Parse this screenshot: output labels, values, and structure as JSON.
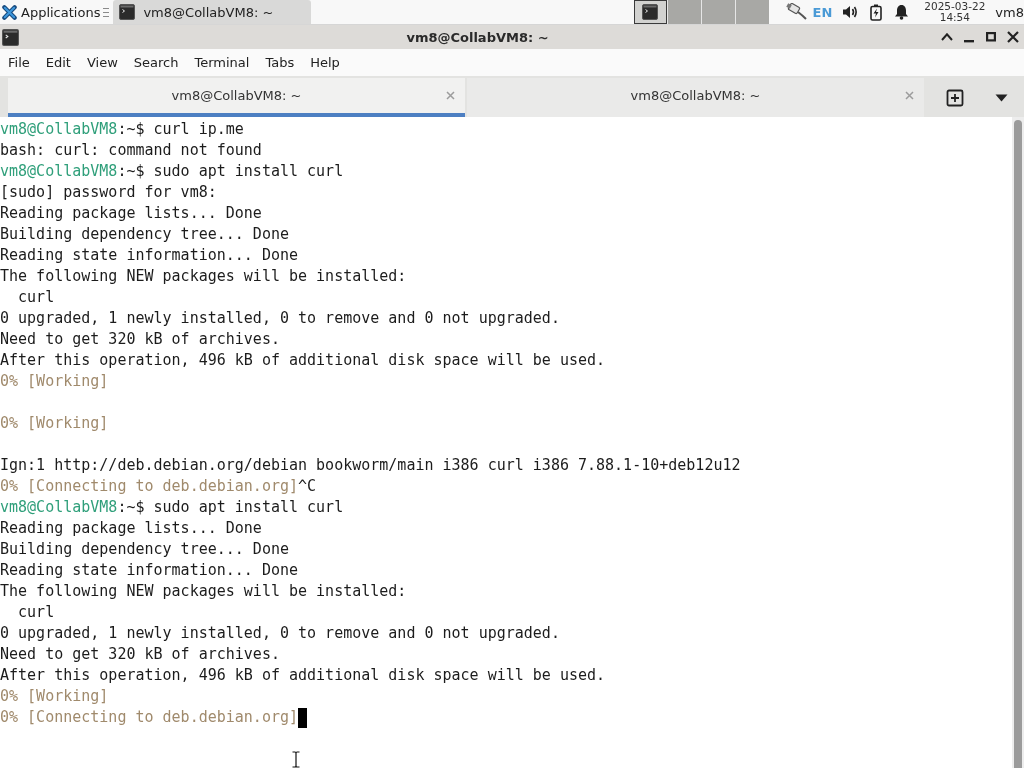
{
  "top_panel": {
    "applications_label": "Applications",
    "task_button": {
      "title": "vm8@CollabVM8: ~"
    },
    "workspaces": [
      {
        "selected": true,
        "has_window": true
      },
      {
        "selected": false,
        "has_window": false
      },
      {
        "selected": false,
        "has_window": false
      },
      {
        "selected": false,
        "has_window": false
      }
    ],
    "keyboard_layout": "EN",
    "clock": {
      "date": "2025-03-22",
      "time": "14:54"
    },
    "user": "vm8"
  },
  "window": {
    "title": "vm8@CollabVM8: ~"
  },
  "menu_bar": [
    "File",
    "Edit",
    "View",
    "Search",
    "Terminal",
    "Tabs",
    "Help"
  ],
  "tabs": [
    {
      "label": "vm8@CollabVM8: ~",
      "selected": true
    },
    {
      "label": "vm8@CollabVM8: ~",
      "selected": false
    }
  ],
  "terminal": {
    "cursor": true,
    "lines": [
      {
        "kind": "prompt",
        "user": "vm8@CollabVM8",
        "text": ":~$ curl ip.me"
      },
      {
        "kind": "output",
        "text": "bash: curl: command not found"
      },
      {
        "kind": "prompt",
        "user": "vm8@CollabVM8",
        "text": ":~$ sudo apt install curl"
      },
      {
        "kind": "output",
        "text": "[sudo] password for vm8:"
      },
      {
        "kind": "output",
        "text": "Reading package lists... Done"
      },
      {
        "kind": "output",
        "text": "Building dependency tree... Done"
      },
      {
        "kind": "output",
        "text": "Reading state information... Done"
      },
      {
        "kind": "output",
        "text": "The following NEW packages will be installed:"
      },
      {
        "kind": "output",
        "text": "  curl"
      },
      {
        "kind": "output",
        "text": "0 upgraded, 1 newly installed, 0 to remove and 0 not upgraded."
      },
      {
        "kind": "output",
        "text": "Need to get 320 kB of archives."
      },
      {
        "kind": "output",
        "text": "After this operation, 496 kB of additional disk space will be used."
      },
      {
        "kind": "progress",
        "text": "0% [Working]"
      },
      {
        "kind": "blank"
      },
      {
        "kind": "progress",
        "text": "0% [Working]"
      },
      {
        "kind": "blank"
      },
      {
        "kind": "output",
        "text": "Ign:1 http://deb.debian.org/debian bookworm/main i386 curl i386 7.88.1-10+deb12u12"
      },
      {
        "kind": "progress",
        "text": "0% [Connecting to deb.debian.org]",
        "suffix": "^C"
      },
      {
        "kind": "prompt",
        "user": "vm8@CollabVM8",
        "text": ":~$ sudo apt install curl"
      },
      {
        "kind": "output",
        "text": "Reading package lists... Done"
      },
      {
        "kind": "output",
        "text": "Building dependency tree... Done"
      },
      {
        "kind": "output",
        "text": "Reading state information... Done"
      },
      {
        "kind": "output",
        "text": "The following NEW packages will be installed:"
      },
      {
        "kind": "output",
        "text": "  curl"
      },
      {
        "kind": "output",
        "text": "0 upgraded, 1 newly installed, 0 to remove and 0 not upgraded."
      },
      {
        "kind": "output",
        "text": "Need to get 320 kB of archives."
      },
      {
        "kind": "output",
        "text": "After this operation, 496 kB of additional disk space will be used."
      },
      {
        "kind": "progress",
        "text": "0% [Working]"
      },
      {
        "kind": "progress",
        "text": "0% [Connecting to deb.debian.org]"
      }
    ]
  }
}
